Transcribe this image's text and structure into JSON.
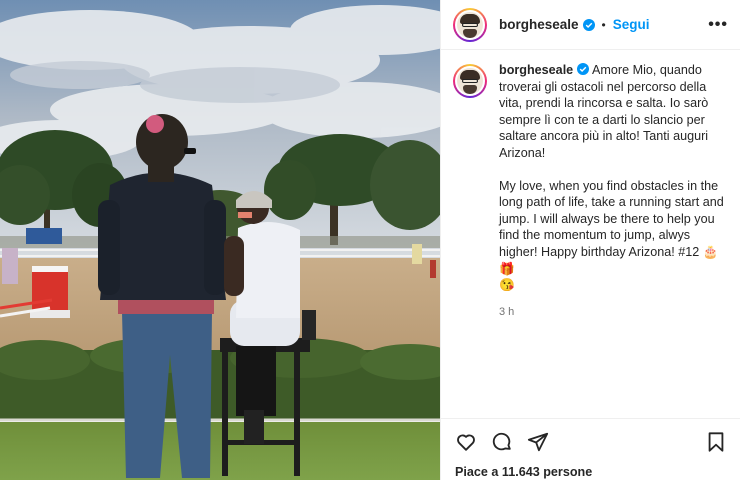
{
  "post": {
    "username": "borgheseale",
    "follow_label": "Segui",
    "separator": "•",
    "more_label": "•••"
  },
  "caption": {
    "username": "borgheseale",
    "text_it": "Amore Mio, quando troverai gli ostacoli nel percorso della vita, prendi la rincorsa e salta. Io sarò sempre lì con te a darti lo slancio per saltare ancora più in alto! Tanti auguri Arizona!",
    "text_en": "My love, when you find obstacles in the long path of life, take a running start and jump. I will always be there to help you find the momentum to jump, alwys higher! Happy birthday Arizona! #12 🎂 🎁",
    "emoji_line": "😘",
    "time_ago": "3 h"
  },
  "actions": {
    "icons": [
      "heart-icon",
      "comment-icon",
      "share-icon",
      "bookmark-icon"
    ],
    "likes_text": "Piace a 11.643 persone"
  },
  "colors": {
    "accent": "#0095f6",
    "verified": "#0095f6",
    "text": "#262626",
    "muted": "#737373"
  }
}
